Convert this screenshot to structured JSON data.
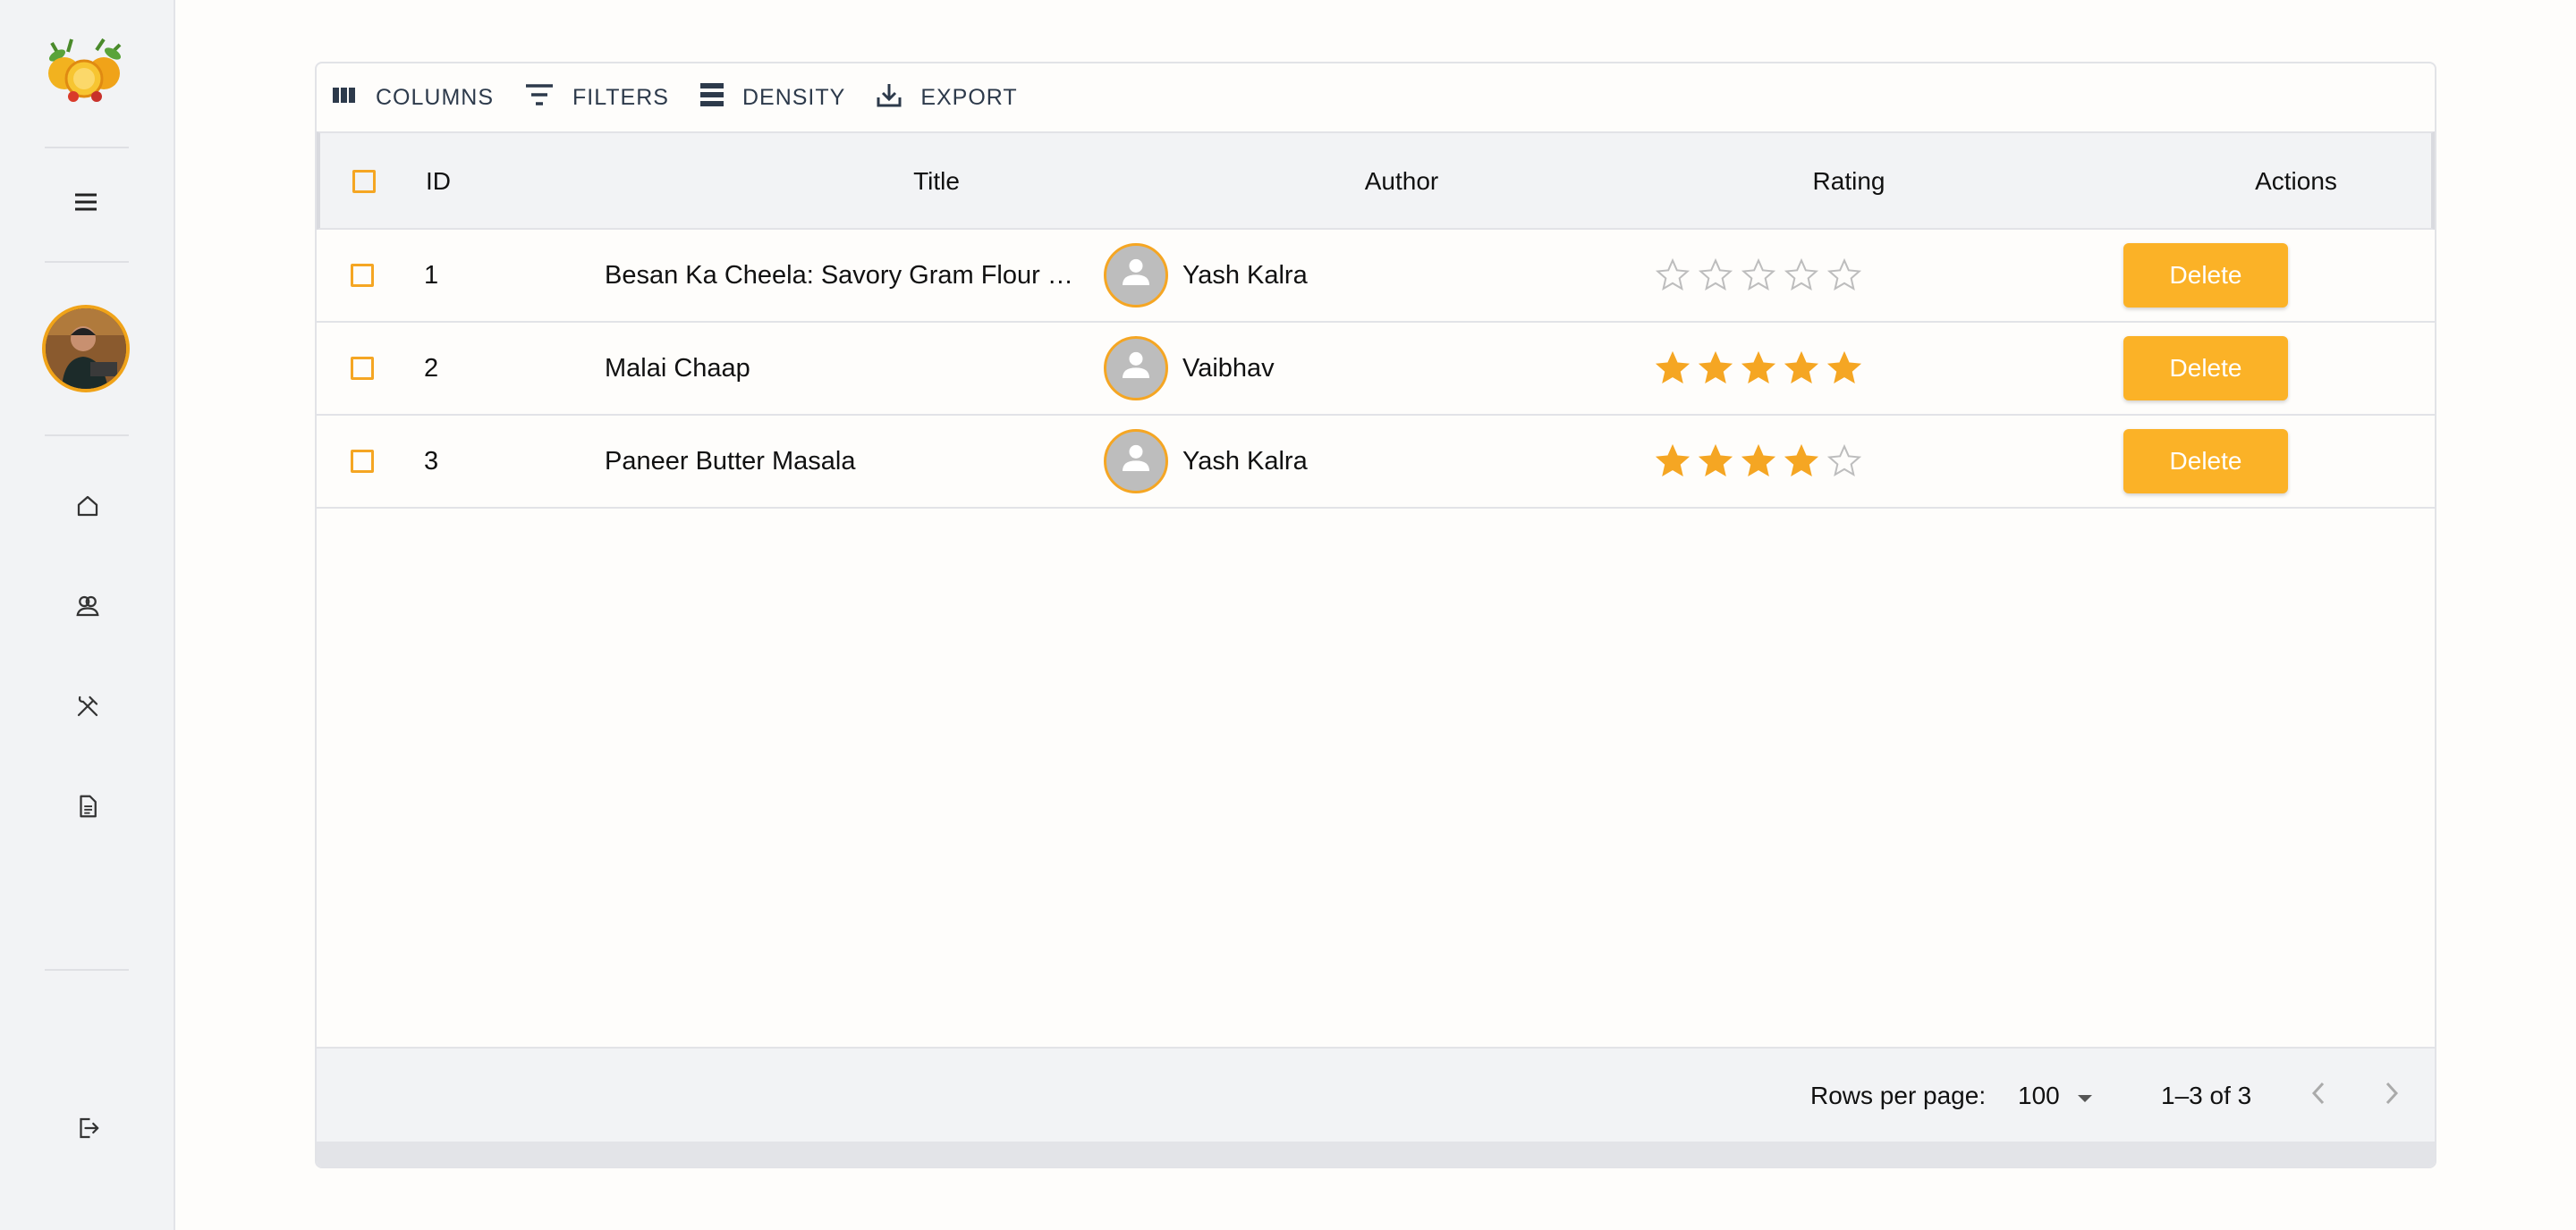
{
  "sidebar": {
    "logo": "fruit-logo",
    "items": [
      {
        "name": "menu",
        "icon": "hamburger-menu-icon"
      },
      {
        "name": "home",
        "icon": "home-icon"
      },
      {
        "name": "users",
        "icon": "users-icon"
      },
      {
        "name": "recipes",
        "icon": "utensils-icon"
      },
      {
        "name": "documents",
        "icon": "document-icon"
      },
      {
        "name": "logout",
        "icon": "logout-icon"
      }
    ]
  },
  "toolbar": {
    "columns_label": "COLUMNS",
    "filters_label": "FILTERS",
    "density_label": "DENSITY",
    "export_label": "EXPORT"
  },
  "table": {
    "headers": {
      "id": "ID",
      "title": "Title",
      "author": "Author",
      "rating": "Rating",
      "actions": "Actions"
    },
    "rows": [
      {
        "id": "1",
        "title": "Besan Ka Cheela: Savory Gram Flour …",
        "author": "Yash Kalra",
        "rating": 0,
        "action": "Delete"
      },
      {
        "id": "2",
        "title": "Malai Chaap",
        "author": "Vaibhav",
        "rating": 5,
        "action": "Delete"
      },
      {
        "id": "3",
        "title": "Paneer Butter Masala",
        "author": "Yash Kalra",
        "rating": 4,
        "action": "Delete"
      }
    ],
    "max_rating": 5
  },
  "footer": {
    "rows_per_page_label": "Rows per page:",
    "rows_per_page_value": "100",
    "pagination_text": "1–3 of 3"
  },
  "colors": {
    "accent": "#f5a623",
    "button": "#fbb227",
    "star_filled": "#f5a623",
    "star_empty": "#bdbdbd"
  }
}
